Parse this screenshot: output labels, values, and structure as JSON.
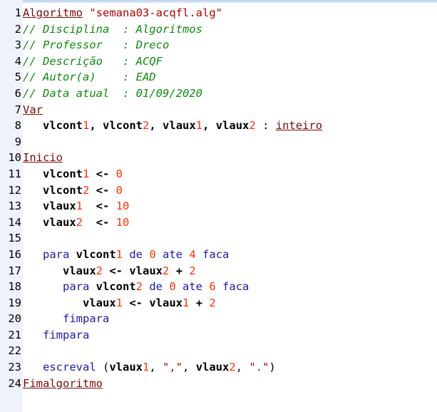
{
  "editor": {
    "colors": {
      "keyword": "#7a0a0a",
      "string": "#b30000",
      "comment": "#108a10",
      "number": "#ff3300",
      "flow_keyword": "#1a1aa8",
      "identifier": "#000000",
      "gutter_bg": "#eef3fb"
    },
    "lines": [
      {
        "n": "1",
        "tokens": [
          {
            "t": "Algoritmo",
            "c": "kw"
          },
          {
            "t": " ",
            "c": "plain"
          },
          {
            "t": "\"semana03-acqfl.alg\"",
            "c": "str"
          }
        ]
      },
      {
        "n": "2",
        "tokens": [
          {
            "t": "// Disciplina  : Algoritmos",
            "c": "cmt"
          }
        ]
      },
      {
        "n": "3",
        "tokens": [
          {
            "t": "// Professor   : Dreco",
            "c": "cmt"
          }
        ]
      },
      {
        "n": "4",
        "tokens": [
          {
            "t": "// Descrição   : ACQF",
            "c": "cmt"
          }
        ]
      },
      {
        "n": "5",
        "tokens": [
          {
            "t": "// Autor(a)    : EAD",
            "c": "cmt"
          }
        ]
      },
      {
        "n": "6",
        "tokens": [
          {
            "t": "// Data atual  : 01/09/2020",
            "c": "cmt"
          }
        ]
      },
      {
        "n": "7",
        "tokens": [
          {
            "t": "Var",
            "c": "kw"
          }
        ]
      },
      {
        "n": "8",
        "tokens": [
          {
            "t": "   ",
            "c": "plain"
          },
          {
            "t": "vlcont",
            "c": "id"
          },
          {
            "t": "1",
            "c": "num"
          },
          {
            "t": ", ",
            "c": "id"
          },
          {
            "t": "vlcont",
            "c": "id"
          },
          {
            "t": "2",
            "c": "num"
          },
          {
            "t": ", ",
            "c": "id"
          },
          {
            "t": "vlaux",
            "c": "id"
          },
          {
            "t": "1",
            "c": "num"
          },
          {
            "t": ", ",
            "c": "id"
          },
          {
            "t": "vlaux",
            "c": "id"
          },
          {
            "t": "2",
            "c": "num"
          },
          {
            "t": " : ",
            "c": "plain"
          },
          {
            "t": "inteiro",
            "c": "kw"
          }
        ]
      },
      {
        "n": "9",
        "tokens": []
      },
      {
        "n": "10",
        "tokens": [
          {
            "t": "Inicio",
            "c": "kw"
          }
        ]
      },
      {
        "n": "11",
        "tokens": [
          {
            "t": "   ",
            "c": "plain"
          },
          {
            "t": "vlcont",
            "c": "id"
          },
          {
            "t": "1",
            "c": "num"
          },
          {
            "t": " <- ",
            "c": "id"
          },
          {
            "t": "0",
            "c": "num"
          }
        ]
      },
      {
        "n": "12",
        "tokens": [
          {
            "t": "   ",
            "c": "plain"
          },
          {
            "t": "vlcont",
            "c": "id"
          },
          {
            "t": "2",
            "c": "num"
          },
          {
            "t": " <- ",
            "c": "id"
          },
          {
            "t": "0",
            "c": "num"
          }
        ]
      },
      {
        "n": "13",
        "tokens": [
          {
            "t": "   ",
            "c": "plain"
          },
          {
            "t": "vlaux",
            "c": "id"
          },
          {
            "t": "1",
            "c": "num"
          },
          {
            "t": "  <- ",
            "c": "id"
          },
          {
            "t": "10",
            "c": "num"
          }
        ]
      },
      {
        "n": "14",
        "tokens": [
          {
            "t": "   ",
            "c": "plain"
          },
          {
            "t": "vlaux",
            "c": "id"
          },
          {
            "t": "2",
            "c": "num"
          },
          {
            "t": "  <- ",
            "c": "id"
          },
          {
            "t": "10",
            "c": "num"
          }
        ]
      },
      {
        "n": "15",
        "tokens": []
      },
      {
        "n": "16",
        "tokens": [
          {
            "t": "   ",
            "c": "plain"
          },
          {
            "t": "para",
            "c": "blue"
          },
          {
            "t": " ",
            "c": "plain"
          },
          {
            "t": "vlcont",
            "c": "id"
          },
          {
            "t": "1",
            "c": "num"
          },
          {
            "t": " de ",
            "c": "blue"
          },
          {
            "t": "0",
            "c": "num"
          },
          {
            "t": " ate ",
            "c": "blue"
          },
          {
            "t": "4",
            "c": "num"
          },
          {
            "t": " faca",
            "c": "blue"
          }
        ]
      },
      {
        "n": "17",
        "tokens": [
          {
            "t": "      ",
            "c": "plain"
          },
          {
            "t": "vlaux",
            "c": "id"
          },
          {
            "t": "2",
            "c": "num"
          },
          {
            "t": " <- vlaux",
            "c": "id"
          },
          {
            "t": "2",
            "c": "num"
          },
          {
            "t": " + ",
            "c": "id"
          },
          {
            "t": "2",
            "c": "num"
          }
        ]
      },
      {
        "n": "18",
        "tokens": [
          {
            "t": "      ",
            "c": "plain"
          },
          {
            "t": "para",
            "c": "blue"
          },
          {
            "t": " ",
            "c": "plain"
          },
          {
            "t": "vlcont",
            "c": "id"
          },
          {
            "t": "2",
            "c": "num"
          },
          {
            "t": " de ",
            "c": "blue"
          },
          {
            "t": "0",
            "c": "num"
          },
          {
            "t": " ate ",
            "c": "blue"
          },
          {
            "t": "6",
            "c": "num"
          },
          {
            "t": " faca",
            "c": "blue"
          }
        ]
      },
      {
        "n": "19",
        "tokens": [
          {
            "t": "         ",
            "c": "plain"
          },
          {
            "t": "vlaux",
            "c": "id"
          },
          {
            "t": "1",
            "c": "num"
          },
          {
            "t": " <- vlaux",
            "c": "id"
          },
          {
            "t": "1",
            "c": "num"
          },
          {
            "t": " + ",
            "c": "id"
          },
          {
            "t": "2",
            "c": "num"
          }
        ]
      },
      {
        "n": "20",
        "tokens": [
          {
            "t": "      ",
            "c": "plain"
          },
          {
            "t": "fimpara",
            "c": "blue"
          }
        ]
      },
      {
        "n": "21",
        "tokens": [
          {
            "t": "   ",
            "c": "plain"
          },
          {
            "t": "fimpara",
            "c": "blue"
          }
        ]
      },
      {
        "n": "22",
        "tokens": []
      },
      {
        "n": "23",
        "tokens": [
          {
            "t": "   ",
            "c": "plain"
          },
          {
            "t": "escreval",
            "c": "blue"
          },
          {
            "t": " (",
            "c": "plain"
          },
          {
            "t": "vlaux",
            "c": "id"
          },
          {
            "t": "1",
            "c": "num"
          },
          {
            "t": ", ",
            "c": "plain"
          },
          {
            "t": "\",\"",
            "c": "str"
          },
          {
            "t": ", ",
            "c": "plain"
          },
          {
            "t": "vlaux",
            "c": "id"
          },
          {
            "t": "2",
            "c": "num"
          },
          {
            "t": ", ",
            "c": "plain"
          },
          {
            "t": "\".\"",
            "c": "str"
          },
          {
            "t": ")",
            "c": "plain"
          }
        ]
      },
      {
        "n": "24",
        "tokens": [
          {
            "t": "Fimalgoritmo",
            "c": "kw"
          }
        ]
      }
    ]
  }
}
